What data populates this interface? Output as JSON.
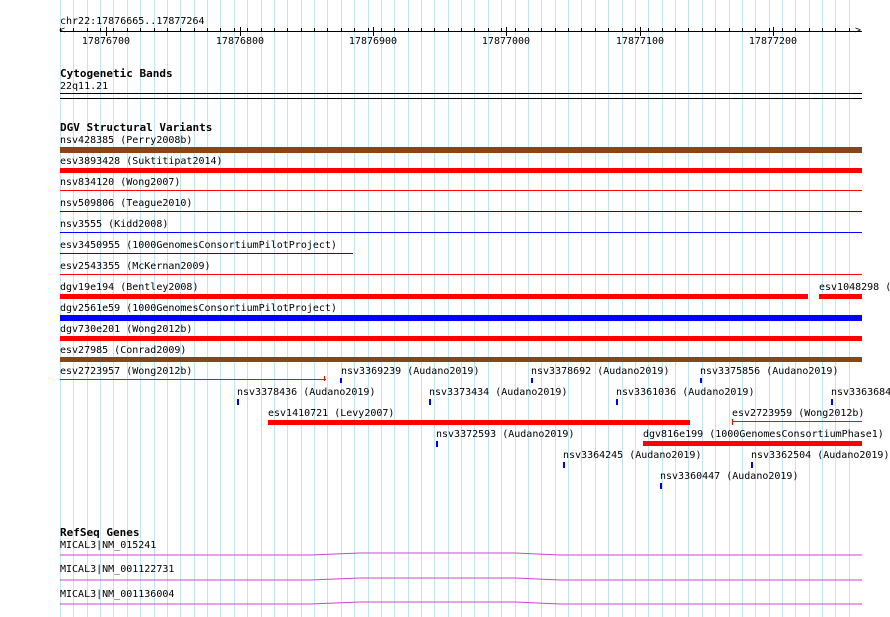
{
  "ruler": {
    "locus": "chr22:17876665..17877264",
    "ticks": [
      "17876700",
      "17876800",
      "17876900",
      "17877000",
      "17877100",
      "17877200"
    ]
  },
  "cytoband": {
    "title": "Cytogenetic Bands",
    "band": "22q11.21"
  },
  "dgv": {
    "title": "DGV Structural Variants",
    "colors": {
      "gain": "#8b4513",
      "loss": "#ff0000",
      "gain_blue": "#0000ff"
    },
    "features": [
      {
        "id": "nsv428385",
        "label": "nsv428385 (Perry2008b)"
      },
      {
        "id": "esv3893428",
        "label": "esv3893428 (Suktitipat2014)"
      },
      {
        "id": "nsv834120",
        "label": "nsv834120 (Wong2007)"
      },
      {
        "id": "nsv509806",
        "label": "nsv509806 (Teague2010)"
      },
      {
        "id": "nsv3555",
        "label": "nsv3555 (Kidd2008)"
      },
      {
        "id": "esv3450955",
        "label": "esv3450955 (1000GenomesConsortiumPilotProject)"
      },
      {
        "id": "esv2543355",
        "label": "esv2543355 (McKernan2009)"
      },
      {
        "id": "dgv19e194",
        "label": "dgv19e194 (Bentley2008)"
      },
      {
        "id": "esv1048298",
        "label": "esv1048298 ("
      },
      {
        "id": "dgv2561e59",
        "label": "dgv2561e59 (1000GenomesConsortiumPilotProject)"
      },
      {
        "id": "dgv730e201",
        "label": "dgv730e201 (Wong2012b)"
      },
      {
        "id": "esv27985",
        "label": "esv27985 (Conrad2009)"
      },
      {
        "id": "esv2723957",
        "label": "esv2723957 (Wong2012b)"
      },
      {
        "id": "nsv3369239",
        "label": "nsv3369239 (Audano2019)"
      },
      {
        "id": "nsv3378692",
        "label": "nsv3378692 (Audano2019)"
      },
      {
        "id": "nsv3375856",
        "label": "nsv3375856 (Audano2019)"
      },
      {
        "id": "nsv3378436",
        "label": "nsv3378436 (Audano2019)"
      },
      {
        "id": "nsv3373434",
        "label": "nsv3373434 (Audano2019)"
      },
      {
        "id": "nsv3361036",
        "label": "nsv3361036 (Audano2019)"
      },
      {
        "id": "nsv3363684",
        "label": "nsv3363684"
      },
      {
        "id": "esv1410721",
        "label": "esv1410721 (Levy2007)"
      },
      {
        "id": "esv2723959",
        "label": "esv2723959 (Wong2012b)"
      },
      {
        "id": "nsv3372593",
        "label": "nsv3372593 (Audano2019)"
      },
      {
        "id": "dgv816e199",
        "label": "dgv816e199 (1000GenomesConsortiumPhase1)"
      },
      {
        "id": "nsv3364245",
        "label": "nsv3364245 (Audano2019)"
      },
      {
        "id": "nsv3362504",
        "label": "nsv3362504 (Audano2019)"
      },
      {
        "id": "nsv3360447",
        "label": "nsv3360447 (Audano2019)"
      }
    ]
  },
  "refseq": {
    "title": "RefSeq Genes",
    "color": "#cc44cc",
    "genes": [
      {
        "label": "MICAL3|NM_015241"
      },
      {
        "label": "MICAL3|NM_001122731"
      },
      {
        "label": "MICAL3|NM_001136004"
      }
    ]
  }
}
